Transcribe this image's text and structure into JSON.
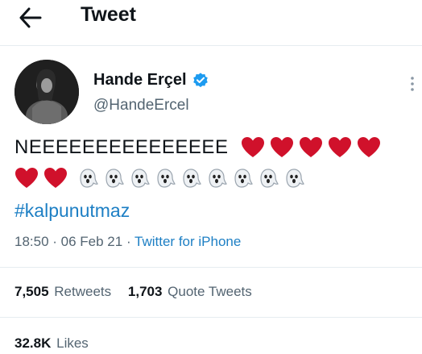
{
  "header": {
    "title": "Tweet",
    "back_icon": "arrow-left-icon"
  },
  "author": {
    "name": "Hande Erçel",
    "handle": "@HandeErcel",
    "verified_icon": "verified-badge-icon",
    "verified_color": "#1d9bf0"
  },
  "tweet": {
    "text": "NEEEEEEEEEEEEEEE",
    "emoji_heart": "red-heart",
    "emoji_ghost": "ghost",
    "hashtag": "#kalpunutmaz"
  },
  "meta": {
    "time": "18:50",
    "separator": " · ",
    "date": "06 Feb 21",
    "source": "Twitter for iPhone"
  },
  "stats": {
    "retweets_count": "7,505",
    "retweets_label": "Retweets",
    "quotes_count": "1,703",
    "quotes_label": "Quote Tweets",
    "likes_count": "32.8K",
    "likes_label": "Likes"
  },
  "colors": {
    "link": "#1d7fc4",
    "muted": "#536471",
    "heart": "#d0112b",
    "divider": "#e6ecf0"
  }
}
